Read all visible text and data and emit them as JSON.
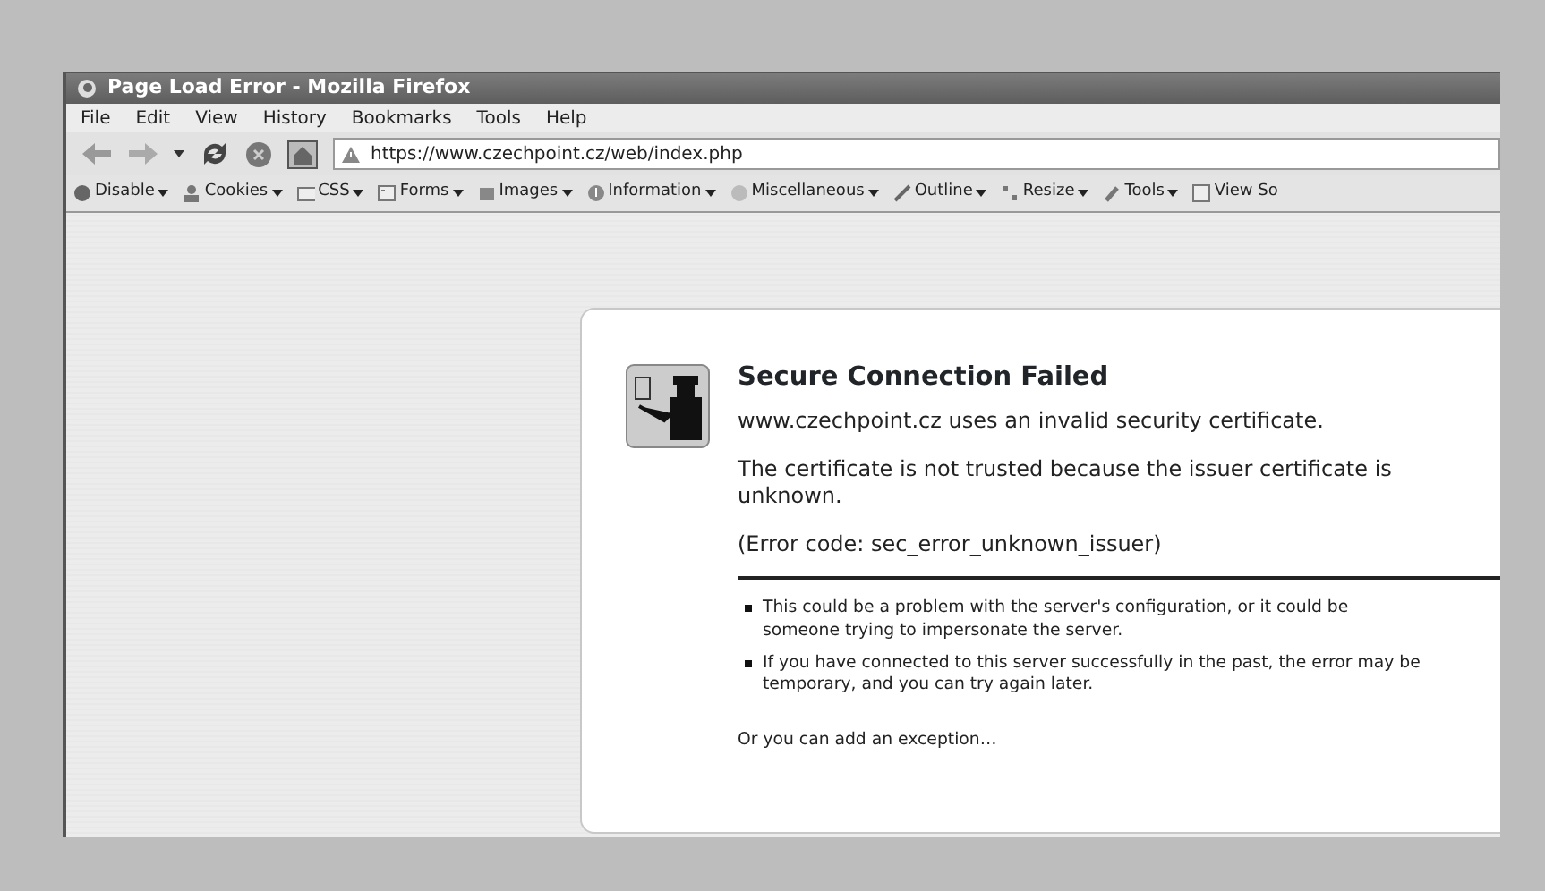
{
  "window": {
    "title": "Page Load Error - Mozilla Firefox"
  },
  "menu": [
    "File",
    "Edit",
    "View",
    "History",
    "Bookmarks",
    "Tools",
    "Help"
  ],
  "address_bar": {
    "url": "https://www.czechpoint.cz/web/index.php"
  },
  "webdev_toolbar": [
    {
      "label": "Disable",
      "dropdown": true
    },
    {
      "label": "Cookies",
      "dropdown": true
    },
    {
      "label": "CSS",
      "dropdown": true
    },
    {
      "label": "Forms",
      "dropdown": true
    },
    {
      "label": "Images",
      "dropdown": true
    },
    {
      "label": "Information",
      "dropdown": true
    },
    {
      "label": "Miscellaneous",
      "dropdown": true
    },
    {
      "label": "Outline",
      "dropdown": true
    },
    {
      "label": "Resize",
      "dropdown": true
    },
    {
      "label": "Tools",
      "dropdown": true
    },
    {
      "label": "View So",
      "dropdown": false
    }
  ],
  "error_page": {
    "title": "Secure Connection Failed",
    "message": "www.czechpoint.cz uses an invalid security certificate.",
    "detail": "The certificate is not trusted because the issuer certificate is unknown.",
    "error_code": "(Error code: sec_error_unknown_issuer)",
    "reasons": [
      "This could be a problem with the server's configuration, or it could be someone trying to impersonate the server.",
      "If you have connected to this server successfully in the past, the error may be temporary, and you can try again later."
    ],
    "exception_link": "Or you can add an exception…"
  }
}
